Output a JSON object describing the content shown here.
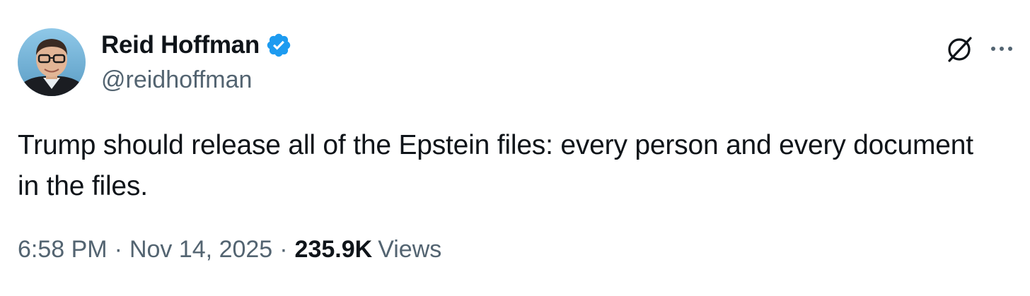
{
  "author": {
    "display_name": "Reid Hoffman",
    "handle": "@reidhoffman",
    "verified": true,
    "verified_color": "#1d9bf0",
    "avatar_icon": "profile-photo"
  },
  "tweet": {
    "text": "Trump should release all of the Epstein files: every person and every document in the files."
  },
  "meta": {
    "time": "6:58 PM",
    "separator": "·",
    "date": "Nov 14, 2025",
    "views_count": "235.9K",
    "views_label": "Views"
  },
  "actions": {
    "grok_icon": "grok-icon",
    "more_icon": "more-options-icon"
  },
  "colors": {
    "text_primary": "#0f1419",
    "text_secondary": "#536471",
    "background": "#ffffff"
  }
}
